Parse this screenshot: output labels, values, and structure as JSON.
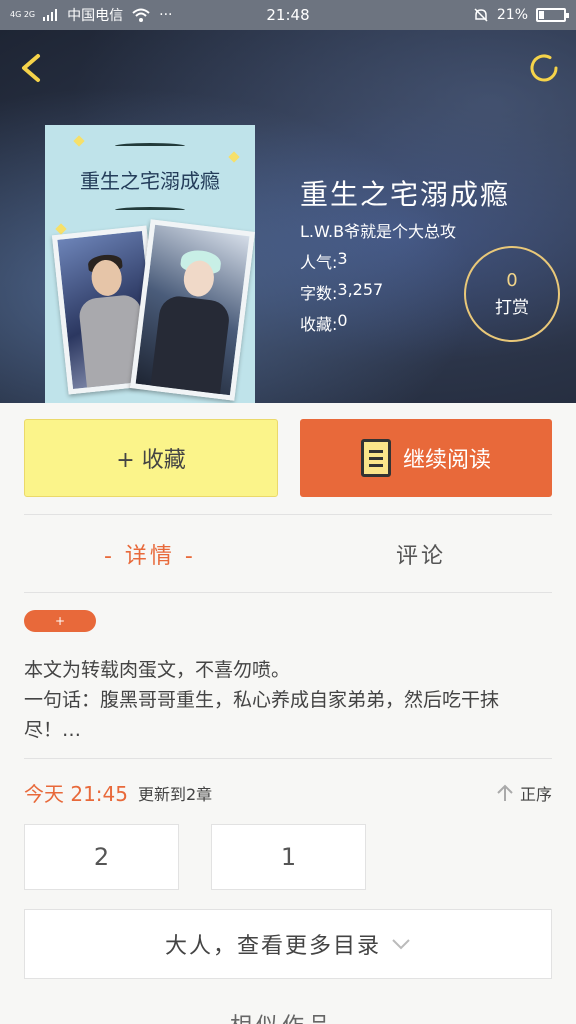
{
  "status_bar": {
    "network": "4G 2G",
    "carrier": "中国电信",
    "dots": "···",
    "time": "21:48",
    "battery": "21%",
    "battery_level": 0.21
  },
  "book": {
    "title": "重生之宅溺成瘾",
    "author": "L.W.B爷就是个大总攻",
    "cover_title": "重生之宅溺成瘾",
    "stats": [
      {
        "label": "人气:",
        "value": "3"
      },
      {
        "label": "字数:",
        "value": "3,257"
      },
      {
        "label": "收藏:",
        "value": "0"
      }
    ],
    "tip": {
      "count": "0",
      "label": "打赏"
    }
  },
  "actions": {
    "collect": "+ 收藏",
    "read": "继续阅读"
  },
  "tabs": [
    {
      "label": "- 详情 -"
    },
    {
      "label": "评论"
    }
  ],
  "tag": "+",
  "description": "本文为转载肉蛋文，不喜勿喷。\n一句话：腹黑哥哥重生，私心养成自家弟弟，然后吃干抹尽！…",
  "update": {
    "time": "今天 21:45",
    "text": "更新到2章",
    "sort_label": "正序"
  },
  "chapters": [
    "2",
    "1"
  ],
  "more_catalog": "大人，查看更多目录",
  "bottom_text": "相似作品"
}
